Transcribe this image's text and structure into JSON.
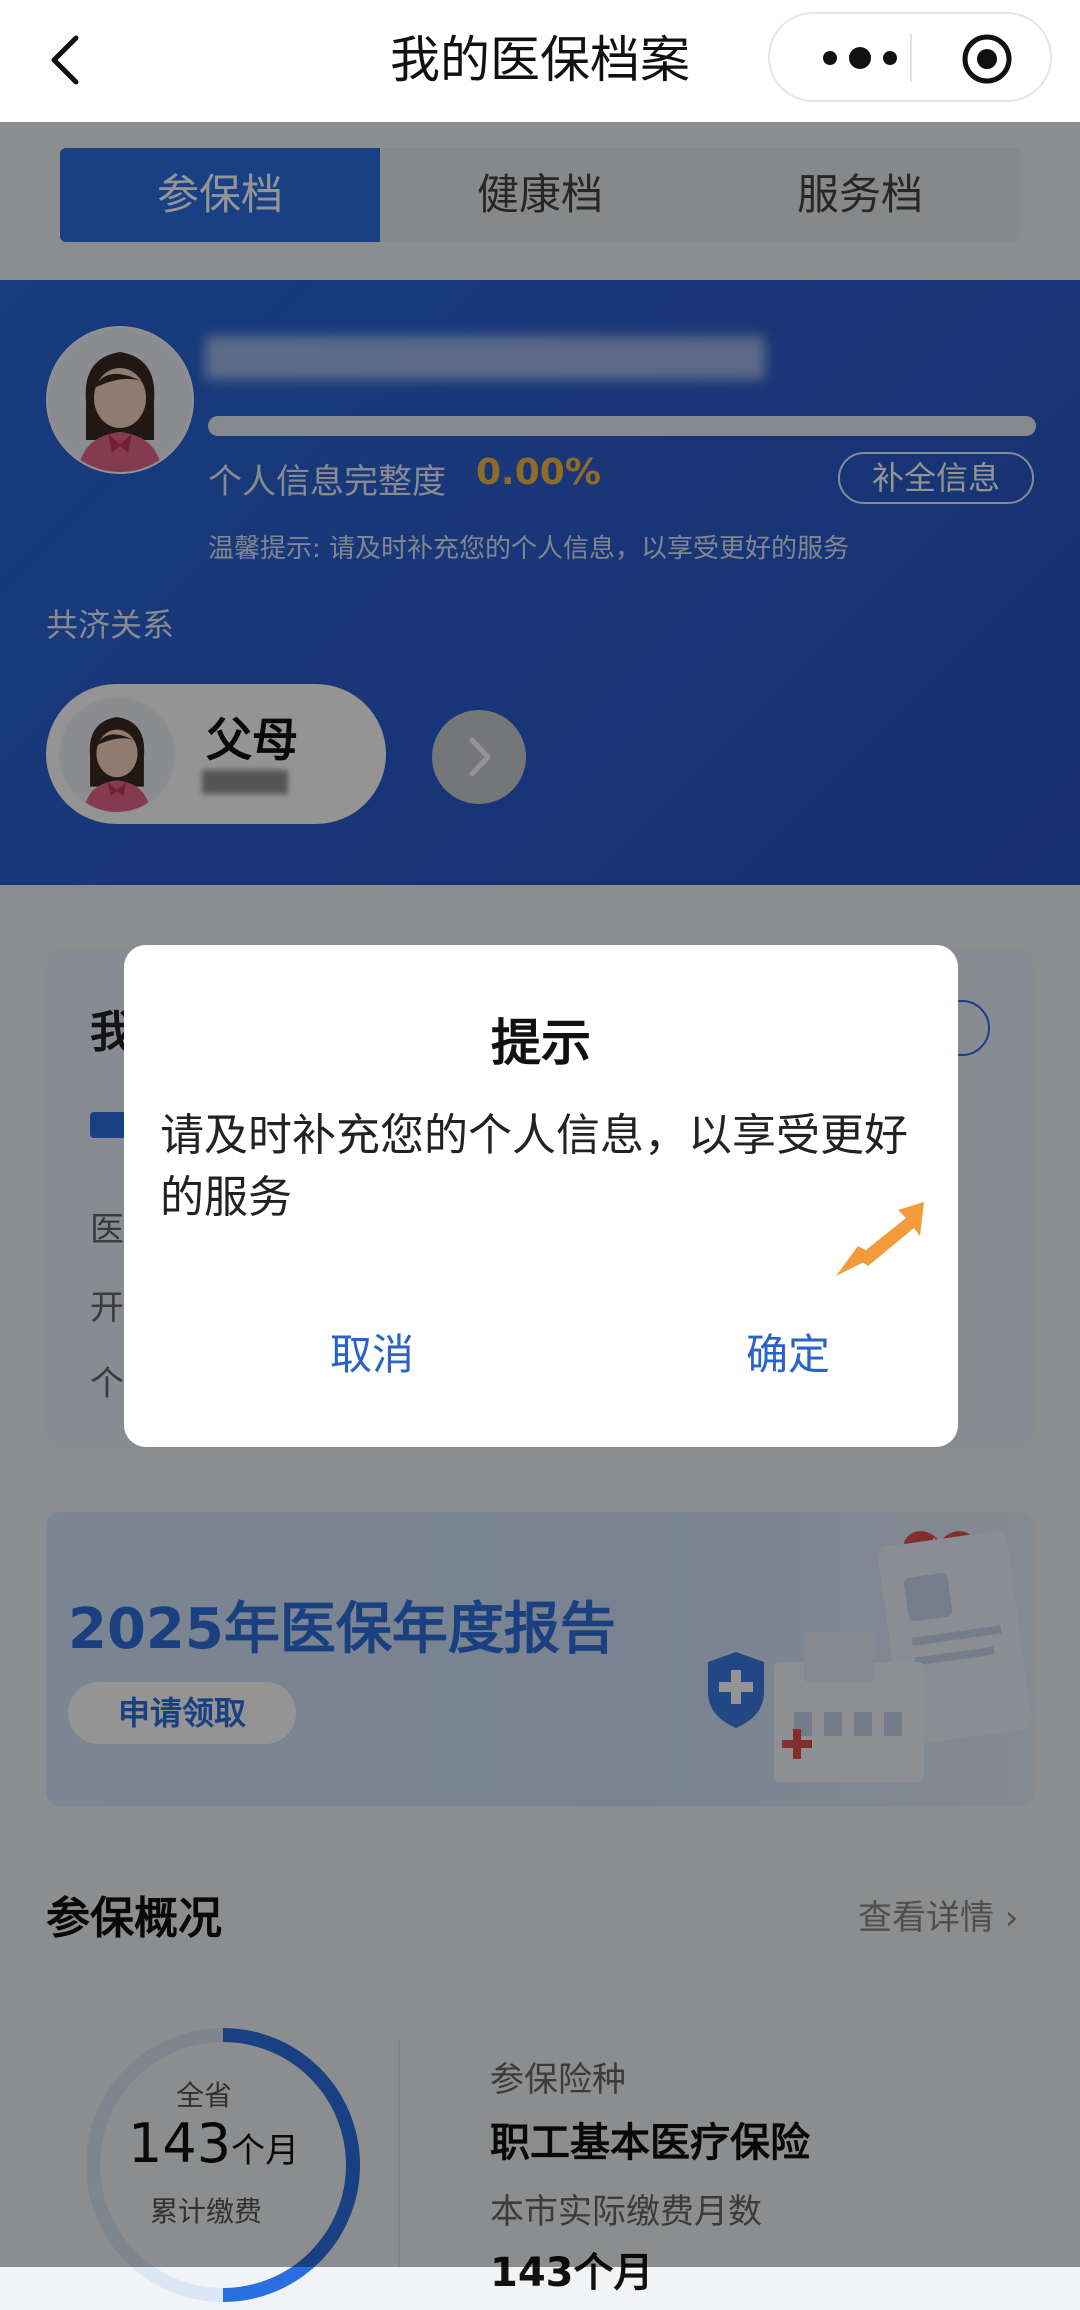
{
  "nav": {
    "title": "我的医保档案"
  },
  "tabs": [
    {
      "label": "参保档"
    },
    {
      "label": "健康档"
    },
    {
      "label": "服务档"
    }
  ],
  "profile": {
    "completeness_label": "个人信息完整度",
    "completeness_value": "0.00%",
    "fill_button": "补全信息",
    "tip": "温馨提示: 请及时补充您的个人信息，以享受更好的服务"
  },
  "mutual_aid": {
    "label": "共济关系",
    "member": "父母"
  },
  "my_card": {
    "title": "我",
    "lines": [
      "医",
      "开",
      "个"
    ]
  },
  "banner": {
    "title": "2025年医保年度报告",
    "button": "申请领取"
  },
  "summary": {
    "title": "参保概况",
    "more": "查看详情 ›",
    "ring_top": "全省",
    "ring_number": "143",
    "ring_unit": "个月",
    "ring_bottom": "累计缴费",
    "insurance_label": "参保险种",
    "insurance_value": "职工基本医疗保险",
    "pay_label": "本市实际缴费月数",
    "pay_value": "143个月"
  },
  "dialog": {
    "title": "提示",
    "content": "请及时补充您的个人信息，以享受更好的服务",
    "cancel": "取消",
    "confirm": "确定"
  },
  "colors": {
    "primary": "#2a6fe0",
    "hero": "#2b5fcf",
    "accent": "#f7b844",
    "dialog_button": "#2a62c8",
    "pointer_arrow": "#f39a3b"
  }
}
